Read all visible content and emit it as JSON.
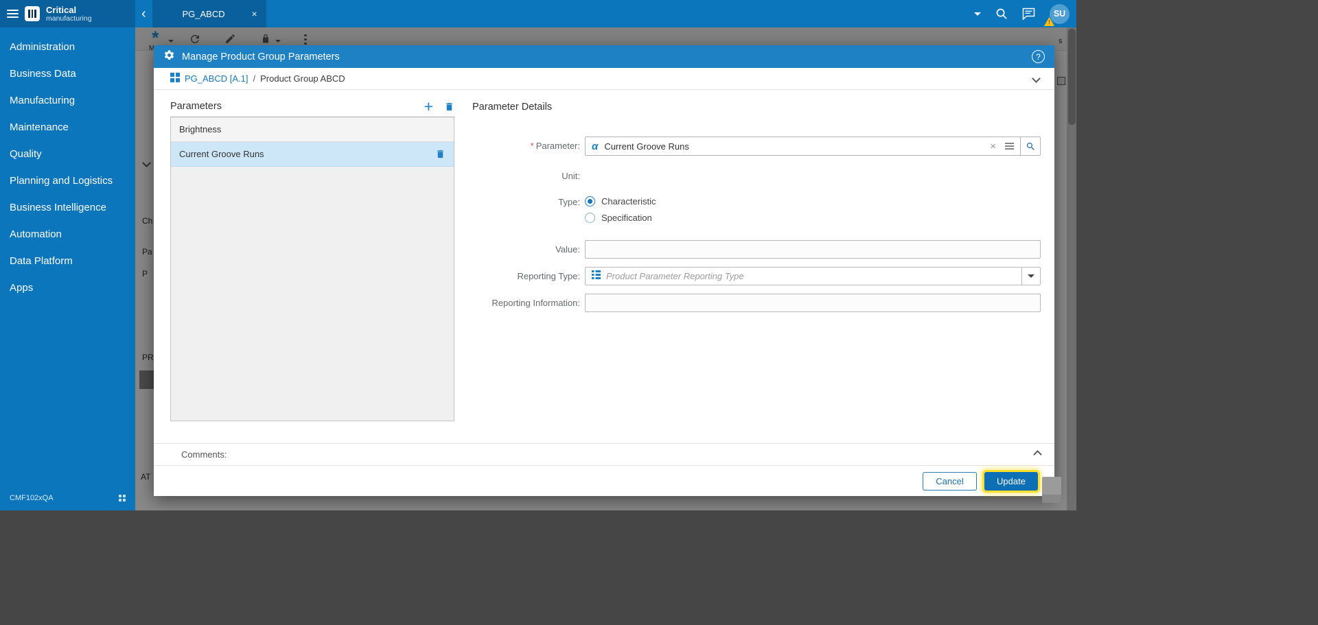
{
  "colors": {
    "brand_blue": "#0b76bc",
    "brand_blue_dark": "#0a5f9d",
    "modal_header_blue": "#1d81c3",
    "accent_blue": "#1d81c3",
    "link_blue": "#1878b9",
    "selected_row_blue": "#cde7f8",
    "primary_button_blue": "#0d6fb5",
    "focus_ring_yellow": "#ffdf2b",
    "required_red": "#d9534f"
  },
  "sidebar": {
    "brand": {
      "top": "Critical",
      "bottom": "manufacturing"
    },
    "items": [
      {
        "label": "Administration"
      },
      {
        "label": "Business Data"
      },
      {
        "label": "Manufacturing"
      },
      {
        "label": "Maintenance"
      },
      {
        "label": "Quality"
      },
      {
        "label": "Planning and Logistics"
      },
      {
        "label": "Business Intelligence"
      },
      {
        "label": "Automation"
      },
      {
        "label": "Data Platform"
      },
      {
        "label": "Apps"
      }
    ],
    "environment": "CMF102xQA"
  },
  "topbar": {
    "tab_label": "PG_ABCD",
    "avatar_initials": "SU"
  },
  "background": {
    "toolbar_fragment": "M",
    "left_fragments": [
      "Ch",
      "Pa",
      "P",
      "PR",
      "AT"
    ],
    "right_fragment": "s"
  },
  "modal": {
    "title": "Manage Product Group Parameters",
    "breadcrumb": {
      "link": "PG_ABCD [A.1]",
      "separator": "/",
      "current": "Product Group ABCD"
    },
    "parameters_panel": {
      "title": "Parameters",
      "items": [
        {
          "label": "Brightness",
          "selected": false
        },
        {
          "label": "Current Groove Runs",
          "selected": true
        }
      ]
    },
    "details": {
      "title": "Parameter Details",
      "required_mark": "*",
      "parameter_label": "Parameter:",
      "parameter_value": "Current Groove Runs",
      "unit_label": "Unit:",
      "type_label": "Type:",
      "type_options": [
        {
          "label": "Characteristic",
          "selected": true
        },
        {
          "label": "Specification",
          "selected": false
        }
      ],
      "value_label": "Value:",
      "value_text": "",
      "reporting_type_label": "Reporting Type:",
      "reporting_type_placeholder": "Product Parameter Reporting Type",
      "reporting_information_label": "Reporting Information:",
      "reporting_information_text": ""
    },
    "comments_label": "Comments:",
    "footer": {
      "cancel_label": "Cancel",
      "update_label": "Update"
    }
  },
  "icons": {
    "plus": "+",
    "close": "×",
    "clear": "×",
    "alpha": "α",
    "back_chevron": "‹",
    "help": "?",
    "warning": "!"
  }
}
